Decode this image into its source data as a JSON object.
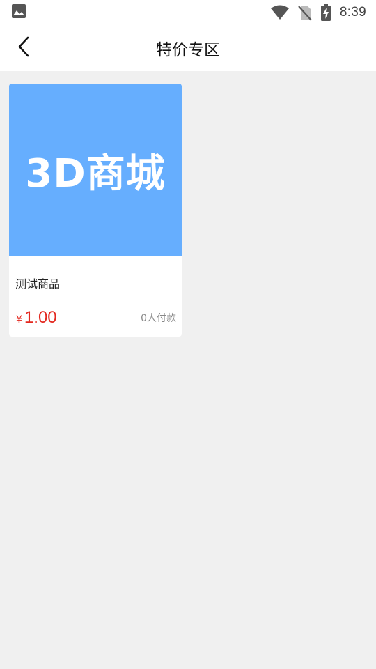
{
  "status_bar": {
    "time": "8:39",
    "icons": [
      "image-notification-icon",
      "wifi-icon",
      "no-sim-icon",
      "battery-charging-icon"
    ]
  },
  "header": {
    "title": "特价专区",
    "back_icon": "chevron-left-icon"
  },
  "products": [
    {
      "image_text": "3D商城",
      "image_color": "#66aefe",
      "name": "测试商品",
      "currency": "¥",
      "price": "1.00",
      "sales": "0人付款"
    }
  ],
  "colors": {
    "price": "#e3281f",
    "background": "#f0f0f0",
    "header_bg": "#ffffff"
  }
}
